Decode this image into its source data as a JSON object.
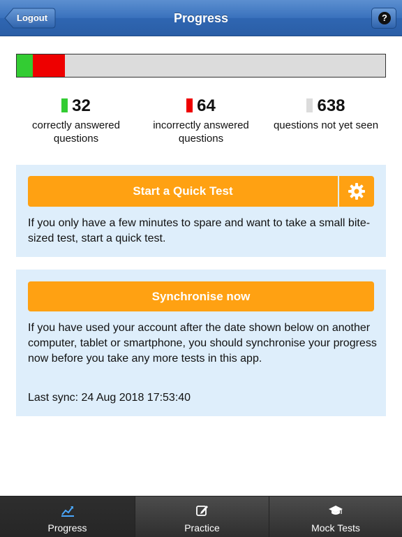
{
  "header": {
    "title": "Progress",
    "back_label": "Logout",
    "help_label": "?"
  },
  "progress": {
    "correct": 32,
    "incorrect": 64,
    "unseen": 638,
    "colors": {
      "correct": "#33cc33",
      "incorrect": "#ee0000",
      "unseen": "#dcdcdc"
    }
  },
  "stats": [
    {
      "value": "32",
      "label_line1": "correctly answered",
      "label_line2": "questions"
    },
    {
      "value": "64",
      "label_line1": "incorrectly answered",
      "label_line2": "questions"
    },
    {
      "value": "638",
      "label_line1": "questions not yet seen",
      "label_line2": ""
    }
  ],
  "quick_test": {
    "button_label": "Start a Quick Test",
    "settings_icon": "gear-icon",
    "description": "If you only have a few minutes to spare and want to take a small bite-sized test, start a quick test."
  },
  "sync": {
    "button_label": "Synchronise now",
    "description": "If you have used your account after the date shown below on another computer, tablet or smartphone, you should synchronise your progress now before you take any more tests in this app.",
    "last_sync": "Last sync: 24 Aug 2018 17:53:40"
  },
  "tabs": [
    {
      "label": "Progress",
      "icon": "chart-icon",
      "active": true
    },
    {
      "label": "Practice",
      "icon": "edit-icon",
      "active": false
    },
    {
      "label": "Mock Tests",
      "icon": "graduation-cap-icon",
      "active": false
    }
  ],
  "colors": {
    "accent": "#ffa112",
    "panel_bg": "#deeefb",
    "nav_blue": "#2f66b2"
  }
}
